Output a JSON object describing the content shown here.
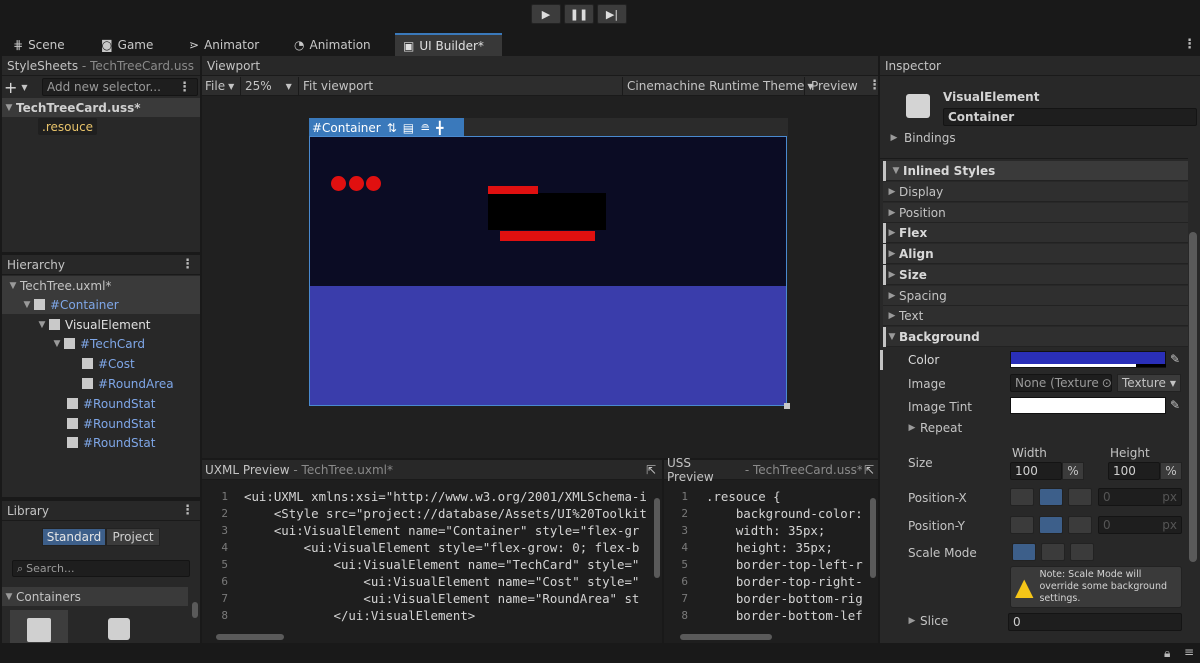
{
  "toolbar": {
    "play": "▶",
    "pause": "❚❚",
    "step": "▶|"
  },
  "tabs": [
    {
      "label": "Scene"
    },
    {
      "label": "Game"
    },
    {
      "label": "Animator"
    },
    {
      "label": "Animation"
    },
    {
      "label": "UI Builder*"
    }
  ],
  "stylesheets": {
    "title": "StyleSheets",
    "file": "- TechTreeCard.uss",
    "selector_placeholder": "Add new selector...",
    "sheet": "TechTreeCard.uss*",
    "selector": ".resouce"
  },
  "hierarchy": {
    "title": "Hierarchy",
    "root": "TechTree.uxml*",
    "items": [
      "#Container",
      "VisualElement",
      "#TechCard",
      "#Cost",
      "#RoundArea",
      "#RoundStat",
      "#RoundStat",
      "#RoundStat"
    ]
  },
  "library": {
    "title": "Library",
    "tab_standard": "Standard",
    "tab_project": "Project",
    "search_placeholder": "Search...",
    "section": "Containers"
  },
  "viewport": {
    "title": "Viewport",
    "file_menu": "File",
    "zoom": "25%",
    "fit": "Fit viewport",
    "theme": "Cinemachine Runtime Theme",
    "preview": "Preview",
    "container_label": "#Container"
  },
  "uxml_preview": {
    "title": "UXML Preview",
    "file": "- TechTree.uxml*",
    "lines": [
      "<ui:UXML xmlns:xsi=\"http://www.w3.org/2001/XMLSchema-i",
      "    <Style src=\"project://database/Assets/UI%20Toolkit",
      "    <ui:VisualElement name=\"Container\" style=\"flex-gr",
      "        <ui:VisualElement style=\"flex-grow: 0; flex-b",
      "            <ui:VisualElement name=\"TechCard\" style=\"",
      "                <ui:VisualElement name=\"Cost\" style=\"",
      "                <ui:VisualElement name=\"RoundArea\" st",
      "            </ui:VisualElement>"
    ],
    "line_numbers": [
      "1",
      "2",
      "3",
      "4",
      "5",
      "6",
      "7",
      "8"
    ]
  },
  "uss_preview": {
    "title": "USS Preview",
    "file": "- TechTreeCard.uss*",
    "lines": [
      ".resouce {",
      "    background-color:",
      "    width: 35px;",
      "    height: 35px;",
      "    border-top-left-r",
      "    border-top-right-",
      "    border-bottom-rig",
      "    border-bottom-lef"
    ],
    "line_numbers": [
      "1",
      "2",
      "3",
      "4",
      "5",
      "6",
      "7",
      "8"
    ]
  },
  "inspector": {
    "title": "Inspector",
    "element_type": "VisualElement",
    "element_name": "Container",
    "bindings": "Bindings",
    "inlined": "Inlined Styles",
    "sections": [
      "Display",
      "Position",
      "Flex",
      "Align",
      "Size",
      "Spacing",
      "Text",
      "Background"
    ],
    "color_label": "Color",
    "color_value": "#2a2fb8",
    "image_label": "Image",
    "image_value": "None (Texture",
    "image_type": "Texture",
    "tint_label": "Image Tint",
    "repeat_label": "Repeat",
    "size_label": "Size",
    "width_label": "Width",
    "height_label": "Height",
    "width_value": "100",
    "height_value": "100",
    "percent": "%",
    "posx_label": "Position-X",
    "posy_label": "Position-Y",
    "px": "px",
    "zero": "0",
    "scale_label": "Scale Mode",
    "note": "Note: Scale Mode will override some background settings.",
    "slice_label": "Slice",
    "slice_value": "0"
  },
  "colors": {
    "accent": "#3a79bb",
    "canvas_top": "#0b0c24",
    "canvas_bottom": "#3a3dab",
    "red": "#e01010"
  }
}
